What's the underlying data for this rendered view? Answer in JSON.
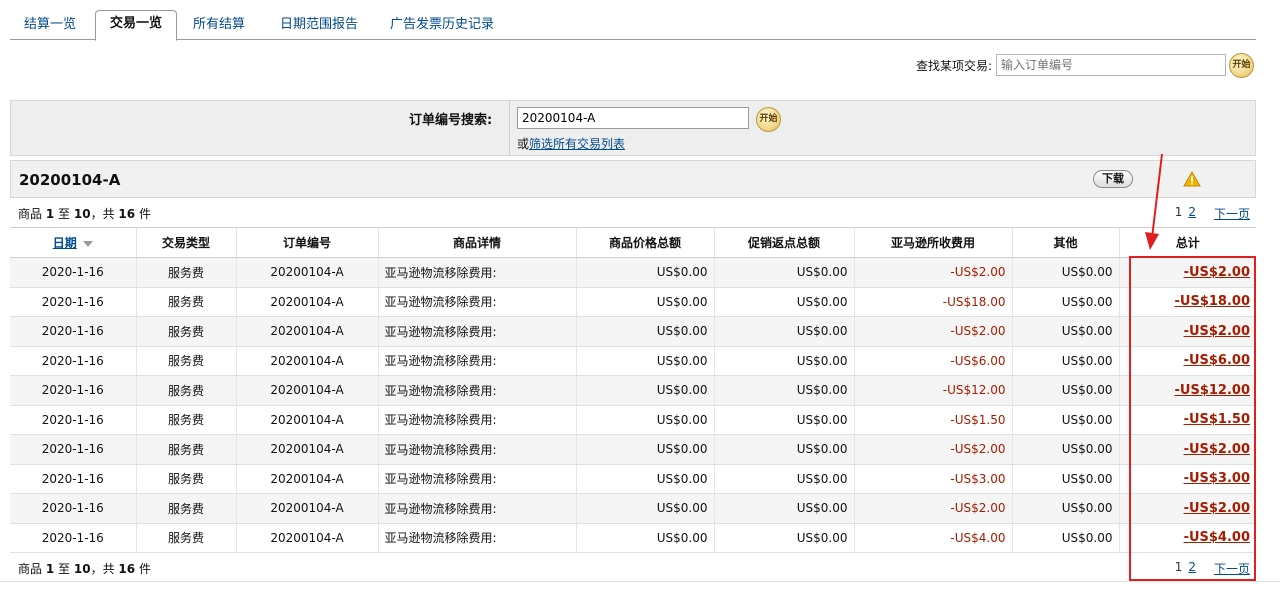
{
  "tabs": [
    {
      "label": "结算一览",
      "active": false
    },
    {
      "label": "交易一览",
      "active": true
    },
    {
      "label": "所有结算",
      "active": false
    },
    {
      "label": "日期范围报告",
      "active": false
    },
    {
      "label": "广告发票历史记录",
      "active": false
    }
  ],
  "top_search": {
    "label": "查找某项交易:",
    "placeholder": "输入订单编号",
    "button": "开始"
  },
  "order_search": {
    "label": "订单编号搜索:",
    "value": "20200104-A",
    "button": "开始",
    "or_text": "或",
    "filter_link": "筛选所有交易列表"
  },
  "result": {
    "title": "20200104-A",
    "download_label": "下载",
    "count_prefix": "商品",
    "count_from": "1",
    "count_to_word": "至",
    "count_to": "10",
    "count_total_word": "，共",
    "count_total": "16",
    "count_suffix": "件",
    "pager": {
      "current": "1",
      "page2": "2",
      "next": "下一页"
    }
  },
  "table": {
    "headers": [
      "日期",
      "交易类型",
      "订单编号",
      "商品详情",
      "商品价格总额",
      "促销返点总额",
      "亚马逊所收费用",
      "其他",
      "总计"
    ],
    "rows": [
      {
        "date": "2020-1-16",
        "type": "服务费",
        "order": "20200104-A",
        "detail": "亚马逊物流移除费用:",
        "price": "US$0.00",
        "promo": "US$0.00",
        "fee": "-US$2.00",
        "other": "US$0.00",
        "total": "-US$2.00"
      },
      {
        "date": "2020-1-16",
        "type": "服务费",
        "order": "20200104-A",
        "detail": "亚马逊物流移除费用:",
        "price": "US$0.00",
        "promo": "US$0.00",
        "fee": "-US$18.00",
        "other": "US$0.00",
        "total": "-US$18.00"
      },
      {
        "date": "2020-1-16",
        "type": "服务费",
        "order": "20200104-A",
        "detail": "亚马逊物流移除费用:",
        "price": "US$0.00",
        "promo": "US$0.00",
        "fee": "-US$2.00",
        "other": "US$0.00",
        "total": "-US$2.00"
      },
      {
        "date": "2020-1-16",
        "type": "服务费",
        "order": "20200104-A",
        "detail": "亚马逊物流移除费用:",
        "price": "US$0.00",
        "promo": "US$0.00",
        "fee": "-US$6.00",
        "other": "US$0.00",
        "total": "-US$6.00"
      },
      {
        "date": "2020-1-16",
        "type": "服务费",
        "order": "20200104-A",
        "detail": "亚马逊物流移除费用:",
        "price": "US$0.00",
        "promo": "US$0.00",
        "fee": "-US$12.00",
        "other": "US$0.00",
        "total": "-US$12.00"
      },
      {
        "date": "2020-1-16",
        "type": "服务费",
        "order": "20200104-A",
        "detail": "亚马逊物流移除费用:",
        "price": "US$0.00",
        "promo": "US$0.00",
        "fee": "-US$1.50",
        "other": "US$0.00",
        "total": "-US$1.50"
      },
      {
        "date": "2020-1-16",
        "type": "服务费",
        "order": "20200104-A",
        "detail": "亚马逊物流移除费用:",
        "price": "US$0.00",
        "promo": "US$0.00",
        "fee": "-US$2.00",
        "other": "US$0.00",
        "total": "-US$2.00"
      },
      {
        "date": "2020-1-16",
        "type": "服务费",
        "order": "20200104-A",
        "detail": "亚马逊物流移除费用:",
        "price": "US$0.00",
        "promo": "US$0.00",
        "fee": "-US$3.00",
        "other": "US$0.00",
        "total": "-US$3.00"
      },
      {
        "date": "2020-1-16",
        "type": "服务费",
        "order": "20200104-A",
        "detail": "亚马逊物流移除费用:",
        "price": "US$0.00",
        "promo": "US$0.00",
        "fee": "-US$2.00",
        "other": "US$0.00",
        "total": "-US$2.00"
      },
      {
        "date": "2020-1-16",
        "type": "服务费",
        "order": "20200104-A",
        "detail": "亚马逊物流移除费用:",
        "price": "US$0.00",
        "promo": "US$0.00",
        "fee": "-US$4.00",
        "other": "US$0.00",
        "total": "-US$4.00"
      }
    ]
  },
  "colors": {
    "link": "#004b91",
    "negative": "#a61c00",
    "annotation": "#e02020",
    "panel_bg": "#eeeeee"
  },
  "icons": {
    "warning": "warning-icon",
    "sort": "sort-arrow-icon"
  }
}
